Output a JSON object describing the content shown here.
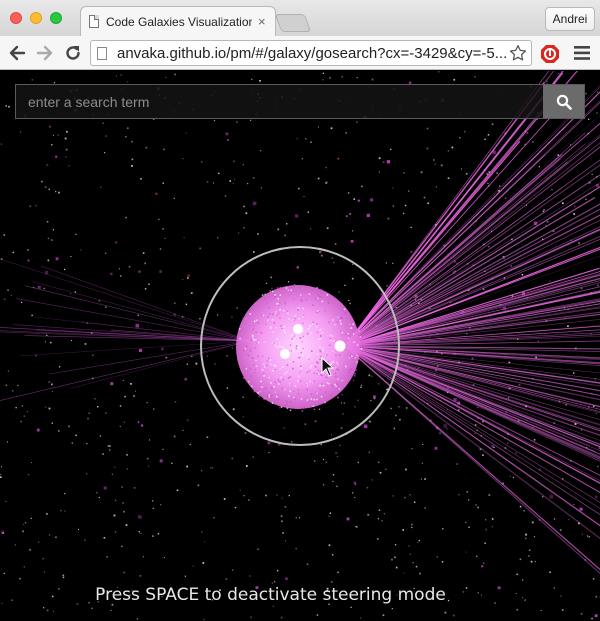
{
  "browser": {
    "tab_title": "Code Galaxies Visualization",
    "tab_close": "×",
    "profile_name": "Andrei",
    "url": "anvaka.github.io/pm/#/galaxy/gosearch?cx=-3429&cy=-5..."
  },
  "search": {
    "placeholder": "enter a search term"
  },
  "hint": {
    "text": "Press SPACE to deactivate steering mode"
  },
  "colors": {
    "accent": "#ff66ee",
    "cluster": "#f08cf0",
    "background": "#000000"
  },
  "icons": {
    "back": "arrow-left-icon",
    "forward": "arrow-right-icon",
    "reload": "reload-icon",
    "bookmark": "star-icon",
    "extension": "stop-sign-icon",
    "menu": "hamburger-menu-icon",
    "search": "magnifier-icon"
  }
}
